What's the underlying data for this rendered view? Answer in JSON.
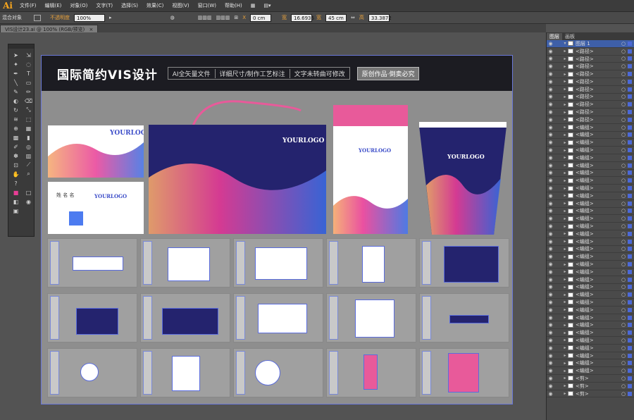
{
  "app": {
    "logo": "Ai",
    "menus": [
      "文件(F)",
      "编辑(E)",
      "对象(O)",
      "文字(T)",
      "选择(S)",
      "效果(C)",
      "视图(V)",
      "窗口(W)",
      "帮助(H)"
    ]
  },
  "control": {
    "object_type": "混合对象",
    "opacity_label": "不透明度",
    "opacity_value": "100%",
    "x_label": "X",
    "x_value": "0 cm",
    "w_label": "宽",
    "w_value": "16.6936",
    "y_value": "45 cm",
    "h_label": "高",
    "h_value": "33.3872"
  },
  "document": {
    "tab_title": "VIS设计23.ai @ 100% (RGB/预览)",
    "close": "×"
  },
  "banner": {
    "title": "国际简约VIS设计",
    "slogans": [
      "AI全矢量文件",
      "详细尺寸/制作工艺标注",
      "文字未转曲可修改"
    ],
    "badge": "原创作品·倒卖必究"
  },
  "cards": {
    "logo": "YOURLOGO",
    "name": "姓 名 名"
  },
  "panel": {
    "tabs": [
      "图层",
      "画板"
    ],
    "top_layer": "图层 1",
    "group_label": "<编组>",
    "path_label": "<路径>",
    "blank_label": "<剪>"
  },
  "colors": {
    "accent": "#4c69d8",
    "navy": "#24236e",
    "pink": "#e83d96",
    "orange": "#f4a86a"
  }
}
